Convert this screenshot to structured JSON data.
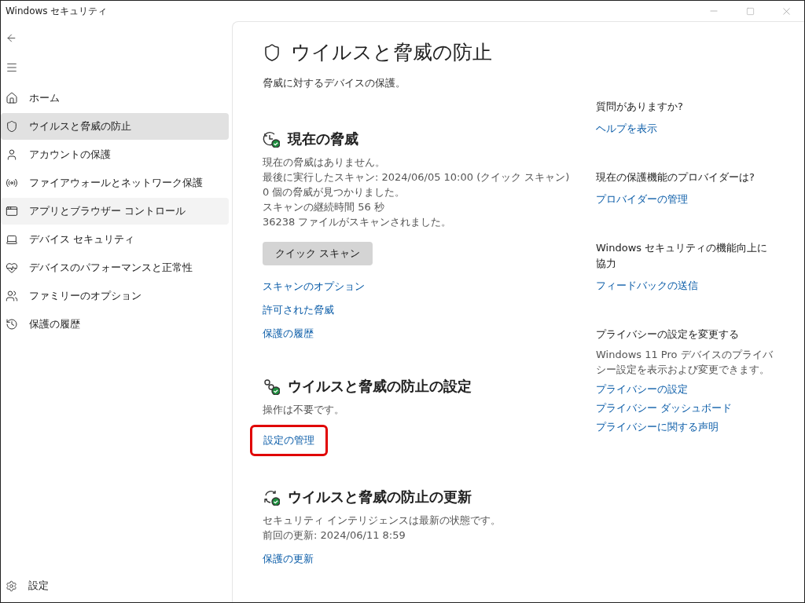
{
  "window": {
    "title": "Windows セキュリティ"
  },
  "sidebar": {
    "items": [
      {
        "kind": "home",
        "label": "ホーム",
        "selected": false,
        "hovered": false
      },
      {
        "kind": "shield",
        "label": "ウイルスと脅威の防止",
        "selected": true,
        "hovered": false
      },
      {
        "kind": "account",
        "label": "アカウントの保護",
        "selected": false,
        "hovered": false
      },
      {
        "kind": "network",
        "label": "ファイアウォールとネットワーク保護",
        "selected": false,
        "hovered": false
      },
      {
        "kind": "app",
        "label": "アプリとブラウザー コントロール",
        "selected": false,
        "hovered": true
      },
      {
        "kind": "device",
        "label": "デバイス セキュリティ",
        "selected": false,
        "hovered": false
      },
      {
        "kind": "health",
        "label": "デバイスのパフォーマンスと正常性",
        "selected": false,
        "hovered": false
      },
      {
        "kind": "family",
        "label": "ファミリーのオプション",
        "selected": false,
        "hovered": false
      },
      {
        "kind": "history",
        "label": "保護の履歴",
        "selected": false,
        "hovered": false
      }
    ],
    "settings": "設定"
  },
  "page": {
    "title": "ウイルスと脅威の防止",
    "subtitle": "脅威に対するデバイスの保護。"
  },
  "sections": [
    {
      "kind": "threats",
      "heading": "現在の脅威",
      "lines": [
        "現在の脅威はありません。",
        "最後に実行したスキャン: 2024/06/05 10:00 (クイック スキャン)",
        "0 個の脅威が見つかりました。",
        "スキャンの継続時間 56 秒",
        "36238 ファイルがスキャンされました。"
      ],
      "button": "クイック スキャン",
      "links": [
        {
          "label": "スキャンのオプション",
          "highlighted": false
        },
        {
          "label": "許可された脅威",
          "highlighted": false
        },
        {
          "label": "保護の履歴",
          "highlighted": false
        }
      ]
    },
    {
      "kind": "settings",
      "heading": "ウイルスと脅威の防止の設定",
      "lines": [
        "操作は不要です。"
      ],
      "links": [
        {
          "label": "設定の管理",
          "highlighted": true
        }
      ]
    },
    {
      "kind": "updates",
      "heading": "ウイルスと脅威の防止の更新",
      "lines": [
        "セキュリティ インテリジェンスは最新の状態です。",
        "前回の更新: 2024/06/11 8:59"
      ],
      "links": [
        {
          "label": "保護の更新",
          "highlighted": false
        }
      ]
    }
  ],
  "aside": [
    {
      "heading": "質問がありますか?",
      "links": [
        "ヘルプを表示"
      ]
    },
    {
      "heading": "現在の保護機能のプロバイダーは?",
      "links": [
        "プロバイダーの管理"
      ]
    },
    {
      "heading": "Windows セキュリティの機能向上に協力",
      "links": [
        "フィードバックの送信"
      ]
    },
    {
      "heading": "プライバシーの設定を変更する",
      "description": "Windows 11 Pro デバイスのプライバシー設定を表示および変更できます。",
      "links": [
        "プライバシーの設定",
        "プライバシー ダッシュボード",
        "プライバシーに関する声明"
      ]
    }
  ]
}
